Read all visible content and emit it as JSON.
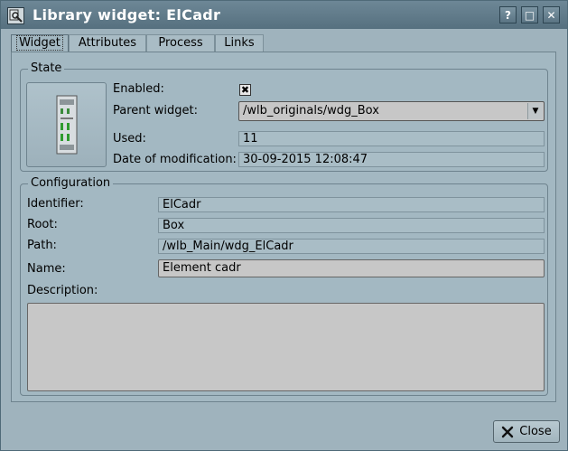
{
  "window": {
    "title": "Library widget: ElCadr",
    "help_glyph": "?",
    "max_glyph": "□",
    "close_glyph": "✕"
  },
  "tabs": [
    {
      "label": "Widget",
      "active": true
    },
    {
      "label": "Attributes",
      "active": false
    },
    {
      "label": "Process",
      "active": false
    },
    {
      "label": "Links",
      "active": false
    }
  ],
  "state": {
    "title": "State",
    "enabled_label": "Enabled:",
    "enabled_checked": true,
    "enabled_mark": "✖",
    "parent_label": "Parent widget:",
    "parent_value": "/wlb_originals/wdg_Box",
    "used_label": "Used:",
    "used_value": "11",
    "date_label": "Date of modification:",
    "date_value": "30-09-2015 12:08:47",
    "preview_icon": "cabinet-icon"
  },
  "config": {
    "title": "Configuration",
    "identifier_label": "Identifier:",
    "identifier_value": "ElCadr",
    "root_label": "Root:",
    "root_value": "Box",
    "path_label": "Path:",
    "path_value": "/wlb_Main/wdg_ElCadr",
    "name_label": "Name:",
    "name_value": "Element cadr",
    "description_label": "Description:",
    "description_value": ""
  },
  "footer": {
    "close_label": "Close",
    "close_icon": "close-x-icon"
  },
  "colors": {
    "background": "#9fb3bd",
    "titlebar": "#5f7988",
    "field": "#c7c7c7"
  }
}
